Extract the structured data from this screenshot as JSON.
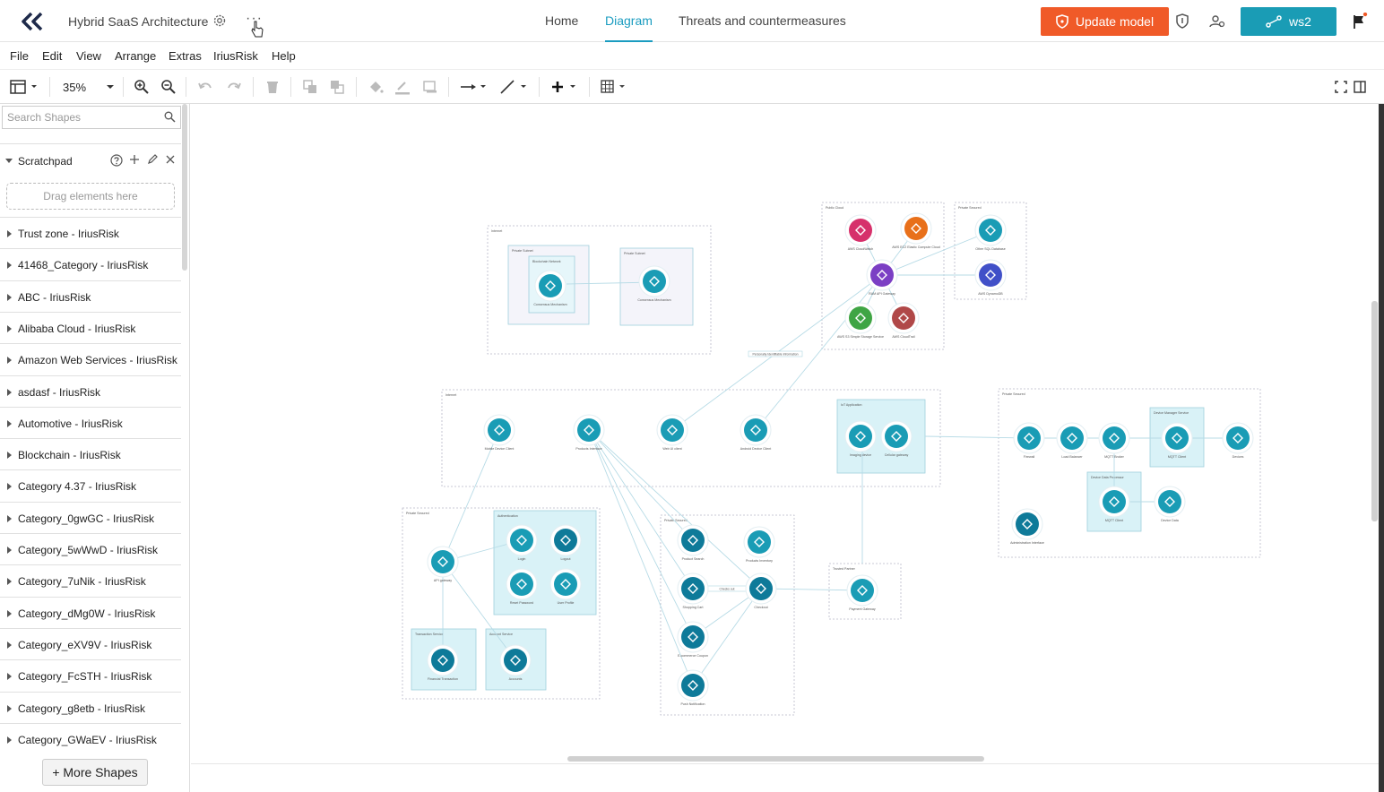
{
  "header": {
    "project_title": "Hybrid SaaS Architecture",
    "more_dots": "···",
    "tabs": [
      {
        "label": "Home",
        "active": false
      },
      {
        "label": "Diagram",
        "active": true
      },
      {
        "label": "Threats and countermeasures",
        "active": false
      }
    ],
    "update_label": "Update model",
    "ws_label": "ws2",
    "accent_color": "#1a9cb5",
    "update_color": "#f05a28"
  },
  "menubar": [
    "File",
    "Edit",
    "View",
    "Arrange",
    "Extras",
    "IriusRisk",
    "Help"
  ],
  "toolbar": {
    "zoom": "35%"
  },
  "sidebar": {
    "search_placeholder": "Search Shapes",
    "scratchpad_label": "Scratchpad",
    "drag_hint": "Drag elements here",
    "libraries": [
      "Trust zone - IriusRisk",
      "41468_Category - IriusRisk",
      "ABC - IriusRisk",
      "Alibaba Cloud - IriusRisk",
      "Amazon Web Services - IriusRisk",
      "asdasf - IriusRisk",
      "Automotive - IriusRisk",
      "Blockchain - IriusRisk",
      "Category 4.37 - IriusRisk",
      "Category_0gwGC - IriusRisk",
      "Category_5wWwD - IriusRisk",
      "Category_7uNik - IriusRisk",
      "Category_dMg0W - IriusRisk",
      "Category_eXV9V - IriusRisk",
      "Category_FcSTH - IriusRisk",
      "Category_g8etb - IriusRisk",
      "Category_GWaEV - IriusRisk"
    ],
    "more_shapes_label": "+ More Shapes"
  },
  "diagram": {
    "zones": [
      {
        "label": "Internet"
      },
      {
        "label": "Private Subnet"
      },
      {
        "label": "Private Subnet"
      },
      {
        "label": "Blockchain Network"
      },
      {
        "label": "Public Cloud"
      },
      {
        "label": "Private Secured"
      },
      {
        "label": "Internet"
      },
      {
        "label": "IoT Application"
      },
      {
        "label": "Private Secured"
      },
      {
        "label": "Device Manager Service"
      },
      {
        "label": "Device Data Processor"
      },
      {
        "label": "Private Secured"
      },
      {
        "label": "Authentication"
      },
      {
        "label": "Transaction Service"
      },
      {
        "label": "Account Service"
      },
      {
        "label": "Private Secured"
      },
      {
        "label": "Trusted Partner"
      }
    ],
    "components": [
      {
        "label": "Consensus Mechanism",
        "icon": "network-icon",
        "color": "#1a9cb5"
      },
      {
        "label": "Consensus Mechanism",
        "icon": "network-icon",
        "color": "#1a9cb5"
      },
      {
        "label": "AWS CloudWatch",
        "icon": "cloudwatch-icon",
        "color": "#d6306b"
      },
      {
        "label": "AWS EC2 Elastic Compute Cloud",
        "icon": "ec2-icon",
        "color": "#e8701a"
      },
      {
        "label": "Other SQL Database",
        "icon": "sql-database-icon",
        "color": "#1a9cb5"
      },
      {
        "label": "RAM API Gateway",
        "icon": "api-gateway-icon",
        "color": "#7b3fc4"
      },
      {
        "label": "AWS DynamoDB",
        "icon": "dynamodb-icon",
        "color": "#4050c8"
      },
      {
        "label": "AWS S3 Simple Storage Service",
        "icon": "s3-icon",
        "color": "#3fa544"
      },
      {
        "label": "AWS CloudTrail",
        "icon": "cloudtrail-icon",
        "color": "#b04848"
      },
      {
        "label": "Mobile Device Client",
        "icon": "mobile-icon",
        "color": "#1a9cb5"
      },
      {
        "label": "Products Interface",
        "icon": "desktop-icon",
        "color": "#1a9cb5"
      },
      {
        "label": "Web UI client",
        "icon": "desktop-icon",
        "color": "#1a9cb5"
      },
      {
        "label": "Android Device Client",
        "icon": "android-icon",
        "color": "#1a9cb5"
      },
      {
        "label": "Imaging device",
        "icon": "camera-icon",
        "color": "#1a9cb5"
      },
      {
        "label": "Cellular gateway",
        "icon": "router-icon",
        "color": "#1a9cb5"
      },
      {
        "label": "Firewall",
        "icon": "firewall-icon",
        "color": "#1a9cb5"
      },
      {
        "label": "Load Balancer",
        "icon": "cloud-icon",
        "color": "#1a9cb5"
      },
      {
        "label": "MQTT Broker",
        "icon": "hub-icon",
        "color": "#1a9cb5"
      },
      {
        "label": "MQTT Client",
        "icon": "hub-icon",
        "color": "#1a9cb5"
      },
      {
        "label": "Devices",
        "icon": "database-icon",
        "color": "#1a9cb5"
      },
      {
        "label": "MQTT Client",
        "icon": "hub-icon",
        "color": "#1a9cb5"
      },
      {
        "label": "Device Data",
        "icon": "database-icon",
        "color": "#1a9cb5"
      },
      {
        "label": "Administration Interface",
        "icon": "component-icon",
        "color": "#0e7a99"
      },
      {
        "label": "API gateway",
        "icon": "gear-network-icon",
        "color": "#1a9cb5"
      },
      {
        "label": "Login",
        "icon": "login-icon",
        "color": "#1a9cb5"
      },
      {
        "label": "Logout",
        "icon": "component-icon",
        "color": "#0e7a99"
      },
      {
        "label": "Reset Password",
        "icon": "fingerprint-icon",
        "color": "#1a9cb5"
      },
      {
        "label": "User Profile",
        "icon": "user-icon",
        "color": "#1a9cb5"
      },
      {
        "label": "Financial Transaction",
        "icon": "component-icon",
        "color": "#0e7a99"
      },
      {
        "label": "Accounts",
        "icon": "component-icon",
        "color": "#0e7a99"
      },
      {
        "label": "Product Search",
        "icon": "component-icon",
        "color": "#0e7a99"
      },
      {
        "label": "Products Inventory",
        "icon": "database-icon",
        "color": "#1a9cb5"
      },
      {
        "label": "Shopping Cart",
        "icon": "component-icon",
        "color": "#0e7a99"
      },
      {
        "label": "Checkout",
        "icon": "component-icon",
        "color": "#0e7a99"
      },
      {
        "label": "E-commerce Coupon",
        "icon": "component-icon",
        "color": "#0e7a99"
      },
      {
        "label": "Push Notification",
        "icon": "component-icon",
        "color": "#0e7a99"
      },
      {
        "label": "Payment Gateway",
        "icon": "payment-icon",
        "color": "#1a9cb5"
      }
    ],
    "flow_labels": [
      "Personally Identifiable Information",
      "Checks out"
    ]
  }
}
